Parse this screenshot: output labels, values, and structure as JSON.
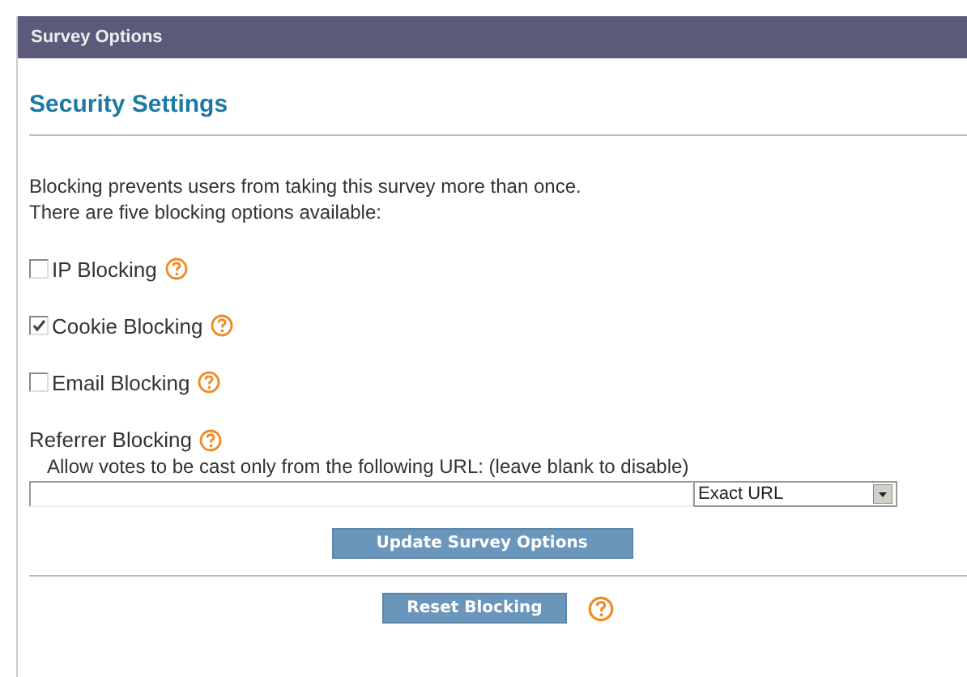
{
  "panel": {
    "title": "Survey Options"
  },
  "heading": "Security Settings",
  "intro": [
    "Blocking prevents users from taking this survey more than once.",
    "There are five blocking options available:"
  ],
  "options": [
    {
      "label": "IP Blocking",
      "checked": false
    },
    {
      "label": "Cookie Blocking",
      "checked": true
    },
    {
      "label": "Email Blocking",
      "checked": false
    }
  ],
  "referrer": {
    "label": "Referrer Blocking",
    "hint": "Allow votes to be cast only from the following URL: (leave blank to disable)",
    "match": "Exact URL"
  },
  "buttons": {
    "update": "Update Survey Options",
    "reset": "Reset Blocking"
  }
}
